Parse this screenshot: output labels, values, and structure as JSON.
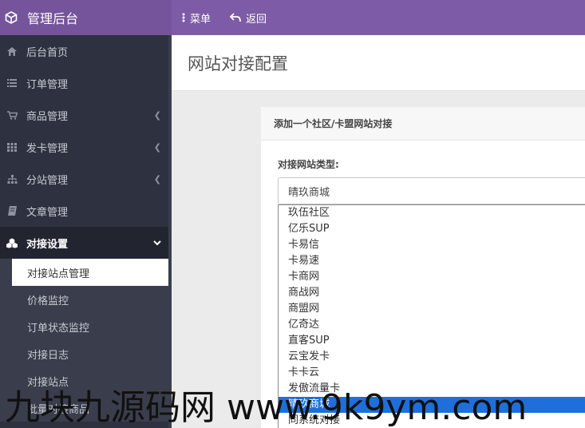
{
  "header": {
    "brand_title": "管理后台",
    "menu_label": "菜单",
    "back_label": "返回"
  },
  "sidebar": {
    "items": [
      {
        "label": "后台首页",
        "icon": "home-icon"
      },
      {
        "label": "订单管理",
        "icon": "list-icon"
      },
      {
        "label": "商品管理",
        "icon": "cart-icon",
        "chevron": "left"
      },
      {
        "label": "发卡管理",
        "icon": "grid-icon",
        "chevron": "left"
      },
      {
        "label": "分站管理",
        "icon": "sitemap-icon",
        "chevron": "left"
      },
      {
        "label": "文章管理",
        "icon": "book-icon"
      },
      {
        "label": "对接设置",
        "icon": "cubes-icon",
        "chevron": "down",
        "active": true
      }
    ],
    "sub_items": [
      {
        "label": "对接站点管理",
        "active": true
      },
      {
        "label": "价格监控"
      },
      {
        "label": "订单状态监控"
      },
      {
        "label": "对接日志"
      },
      {
        "label": "对接站点"
      },
      {
        "label": "批量对接商品"
      }
    ]
  },
  "page": {
    "title": "网站对接配置",
    "panel_title": "添加一个社区/卡盟网站对接",
    "field_label": "对接网站类型:",
    "select_value": "晴玖商城"
  },
  "dropdown_options": [
    "玖伍社区",
    "亿乐SUP",
    "卡易信",
    "卡易速",
    "卡商网",
    "商战网",
    "商盟网",
    "亿奇达",
    "直客SUP",
    "云宝发卡",
    "卡卡云",
    "发傲流量卡",
    "晴玖商城",
    "同系统对接"
  ],
  "selected_option_index": 12,
  "watermark": "九块九源码网 www.9k9ym.com",
  "colors": {
    "topbar": "#7d5ba6",
    "sidebar": "#2e3240",
    "selected_option": "#1e6fd9"
  }
}
